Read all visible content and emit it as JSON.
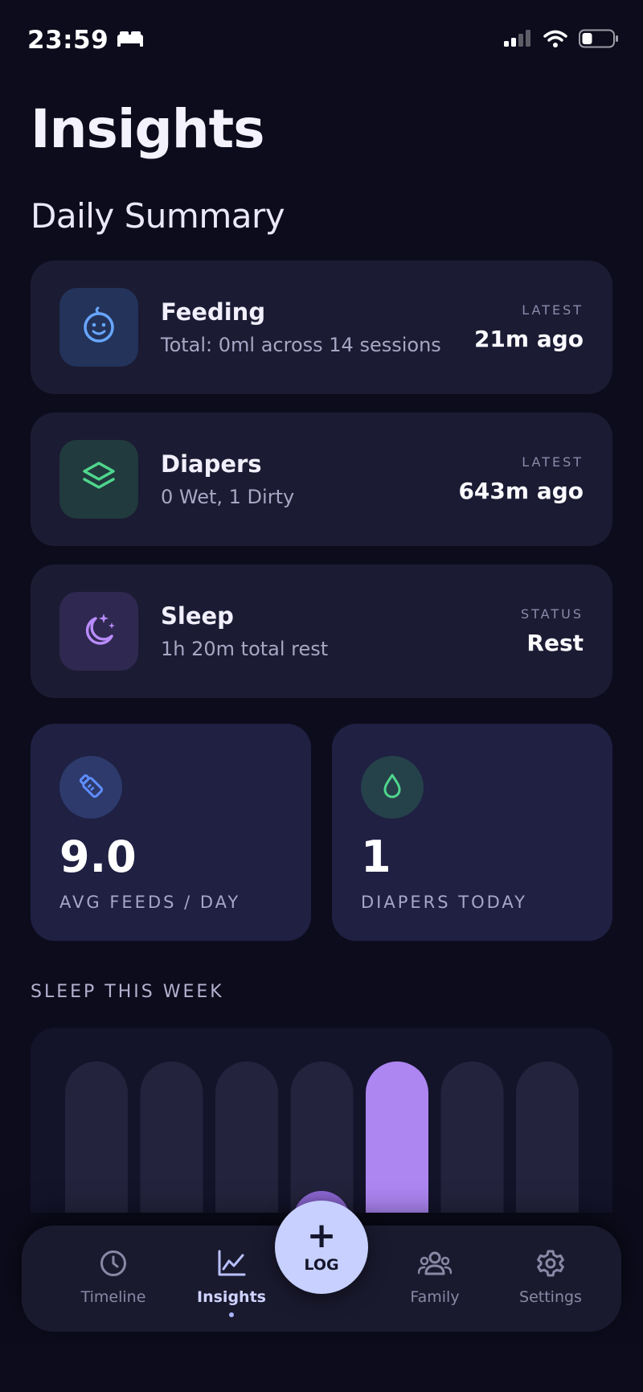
{
  "status_bar": {
    "time": "23:59",
    "sleep_mode_icon": "bed-icon",
    "signal_icon": "cellular-signal-icon",
    "wifi_icon": "wifi-icon",
    "battery_icon": "battery-icon"
  },
  "header": {
    "title": "Insights",
    "section_title": "Daily Summary"
  },
  "summary_cards": [
    {
      "title": "Feeding",
      "subtitle": "Total: 0ml across 14 sessions",
      "right_label": "LATEST",
      "right_value": "21m ago",
      "icon": "baby-face-icon",
      "accent": "#67a6ff"
    },
    {
      "title": "Diapers",
      "subtitle": "0 Wet, 1 Dirty",
      "right_label": "LATEST",
      "right_value": "643m ago",
      "icon": "layers-icon",
      "accent": "#4fd68d"
    },
    {
      "title": "Sleep",
      "subtitle": "1h 20m total rest",
      "right_label": "STATUS",
      "right_value": "Rest",
      "icon": "moon-stars-icon",
      "accent": "#b98cff"
    }
  ],
  "stats": [
    {
      "value": "9.0",
      "label": "AVG FEEDS / DAY",
      "icon": "bottle-icon",
      "accent": "#5f8dff"
    },
    {
      "value": "1",
      "label": "DIAPERS TODAY",
      "icon": "droplet-icon",
      "accent": "#4fd68d"
    }
  ],
  "sleep_chart": {
    "heading": "SLEEP THIS WEEK",
    "active_color": "#ad86f2",
    "inactive_color": "#23233d",
    "highlighted_index": 4,
    "bar_count": 7
  },
  "bottom_nav": {
    "items": [
      {
        "label": "Timeline",
        "icon": "clock-icon",
        "active": false
      },
      {
        "label": "Insights",
        "icon": "chart-line-icon",
        "active": true
      },
      {
        "label": "Family",
        "icon": "people-icon",
        "active": false
      },
      {
        "label": "Settings",
        "icon": "gear-icon",
        "active": false
      }
    ],
    "fab": {
      "symbol": "+",
      "label": "LOG",
      "color": "#c7d0ff"
    }
  },
  "colors": {
    "background": "#0c0c1d",
    "card": "#1b1b33",
    "stat_card": "#1f2042"
  }
}
